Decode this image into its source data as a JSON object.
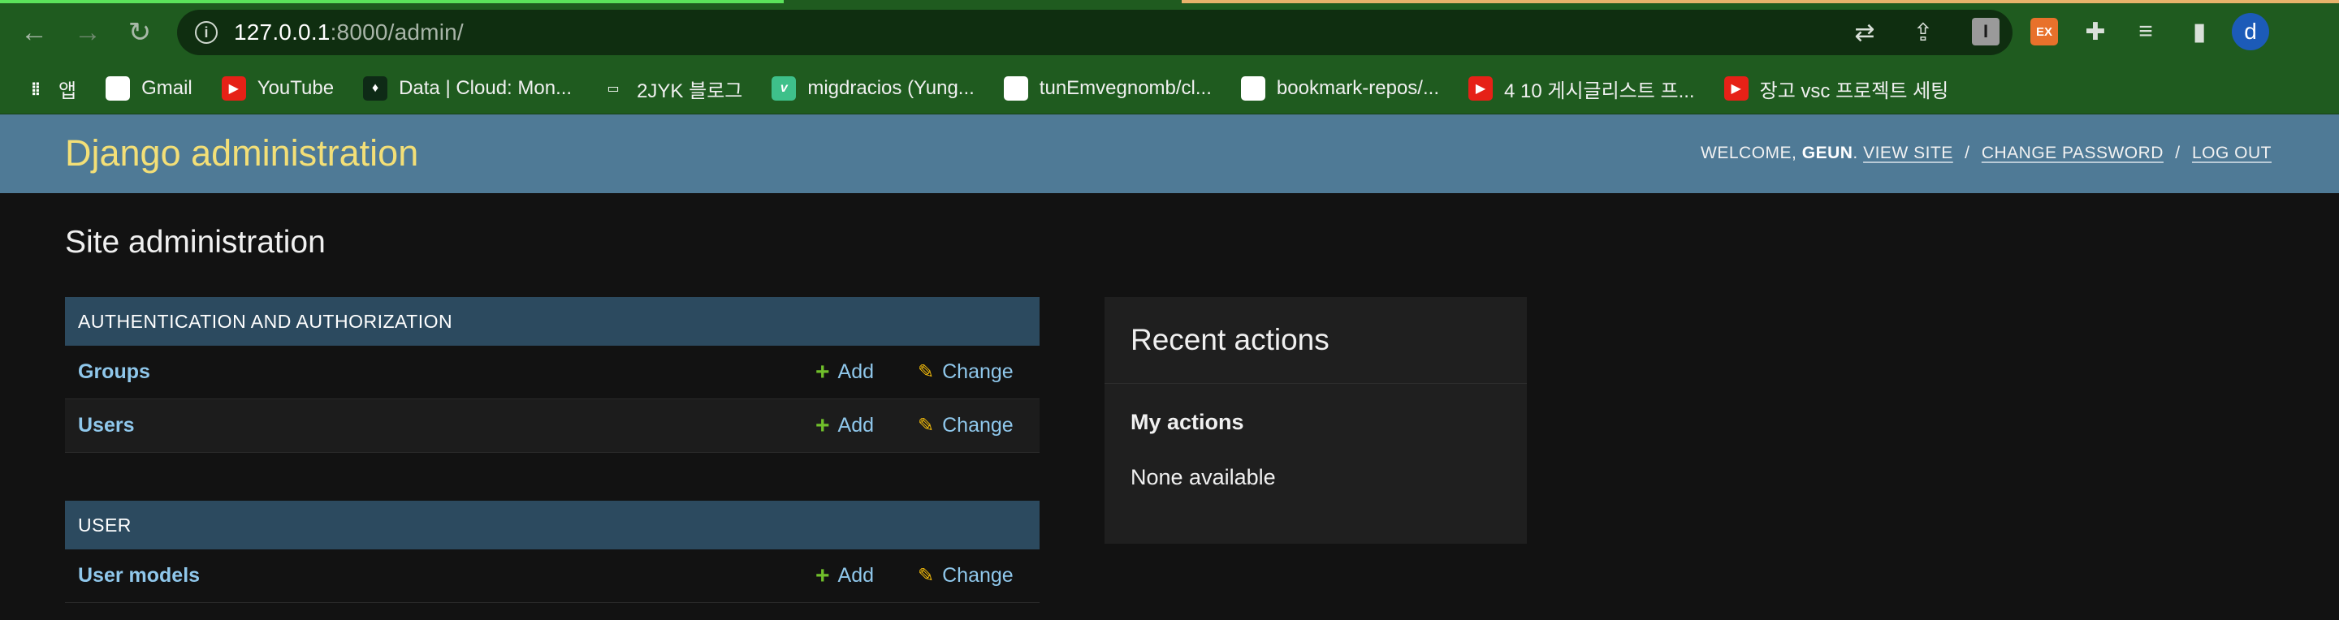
{
  "browser": {
    "url_host": "127.0.0.1",
    "url_rest": ":8000/admin/",
    "avatar_letter": "d",
    "ext_i_label": "I",
    "ext_ex_label": "EX",
    "bookmarks": [
      {
        "label": "앱",
        "icon": "apps-grid-icon"
      },
      {
        "label": "Gmail",
        "icon": "gmail-icon"
      },
      {
        "label": "YouTube",
        "icon": "youtube-icon"
      },
      {
        "label": "Data | Cloud: Mon...",
        "icon": "mongodb-leaf-icon"
      },
      {
        "label": "2JYK 블로그",
        "icon": "folder-icon"
      },
      {
        "label": "migdracios (Yung...",
        "icon": "vimeo-icon"
      },
      {
        "label": "tunEmvegnomb/cl...",
        "icon": "github-icon"
      },
      {
        "label": "bookmark-repos/...",
        "icon": "github-icon"
      },
      {
        "label": "4 10 게시글리스트 프...",
        "icon": "youtube-icon"
      },
      {
        "label": "장고 vsc 프로젝트 세팅",
        "icon": "youtube-icon"
      }
    ]
  },
  "header": {
    "brand": "Django administration",
    "welcome": "WELCOME,",
    "username": "GEUN",
    "view_site": "VIEW SITE",
    "change_password": "CHANGE PASSWORD",
    "log_out": "LOG OUT",
    "separator": "/"
  },
  "main": {
    "title": "Site administration",
    "modules": [
      {
        "caption": "AUTHENTICATION AND AUTHORIZATION",
        "rows": [
          {
            "name": "Groups",
            "add": "Add",
            "change": "Change"
          },
          {
            "name": "Users",
            "add": "Add",
            "change": "Change"
          }
        ]
      },
      {
        "caption": "USER",
        "rows": [
          {
            "name": "User models",
            "add": "Add",
            "change": "Change"
          }
        ]
      }
    ]
  },
  "recent_actions": {
    "title": "Recent actions",
    "my_actions": "My actions",
    "none_available": "None available"
  },
  "colors": {
    "chrome": "#1f5b1f",
    "admin_header": "#4f7a96",
    "brand_yellow": "#f3df77",
    "module_caption": "#2c4a5f",
    "link_blue": "#8fc7eb",
    "add_green": "#70bf2b",
    "change_yellow": "#efb80b"
  }
}
